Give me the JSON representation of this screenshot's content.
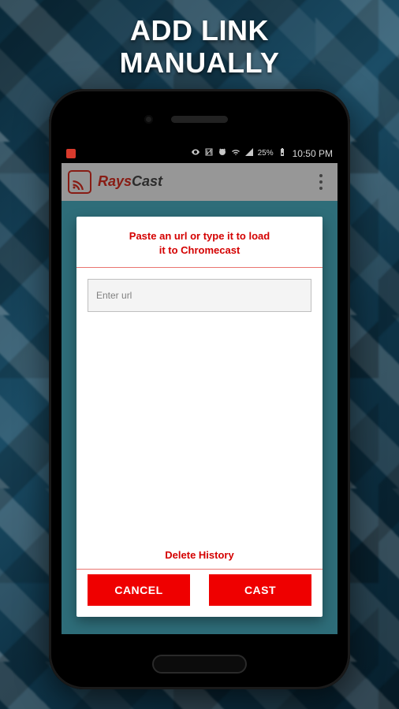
{
  "promo": {
    "line1": "ADD LINK",
    "line2": "MANUALLY"
  },
  "statusbar": {
    "battery_percent": "25%",
    "clock": "10:50 PM"
  },
  "actionbar": {
    "app_name_accent": "Rays",
    "app_name_rest": "Cast"
  },
  "dialog": {
    "title_line1": "Paste an url or type it to load",
    "title_line2": "it to Chromecast",
    "url_placeholder": "Enter url",
    "url_value": "",
    "delete_history": "Delete History",
    "cancel": "CANCEL",
    "cast": "CAST"
  }
}
